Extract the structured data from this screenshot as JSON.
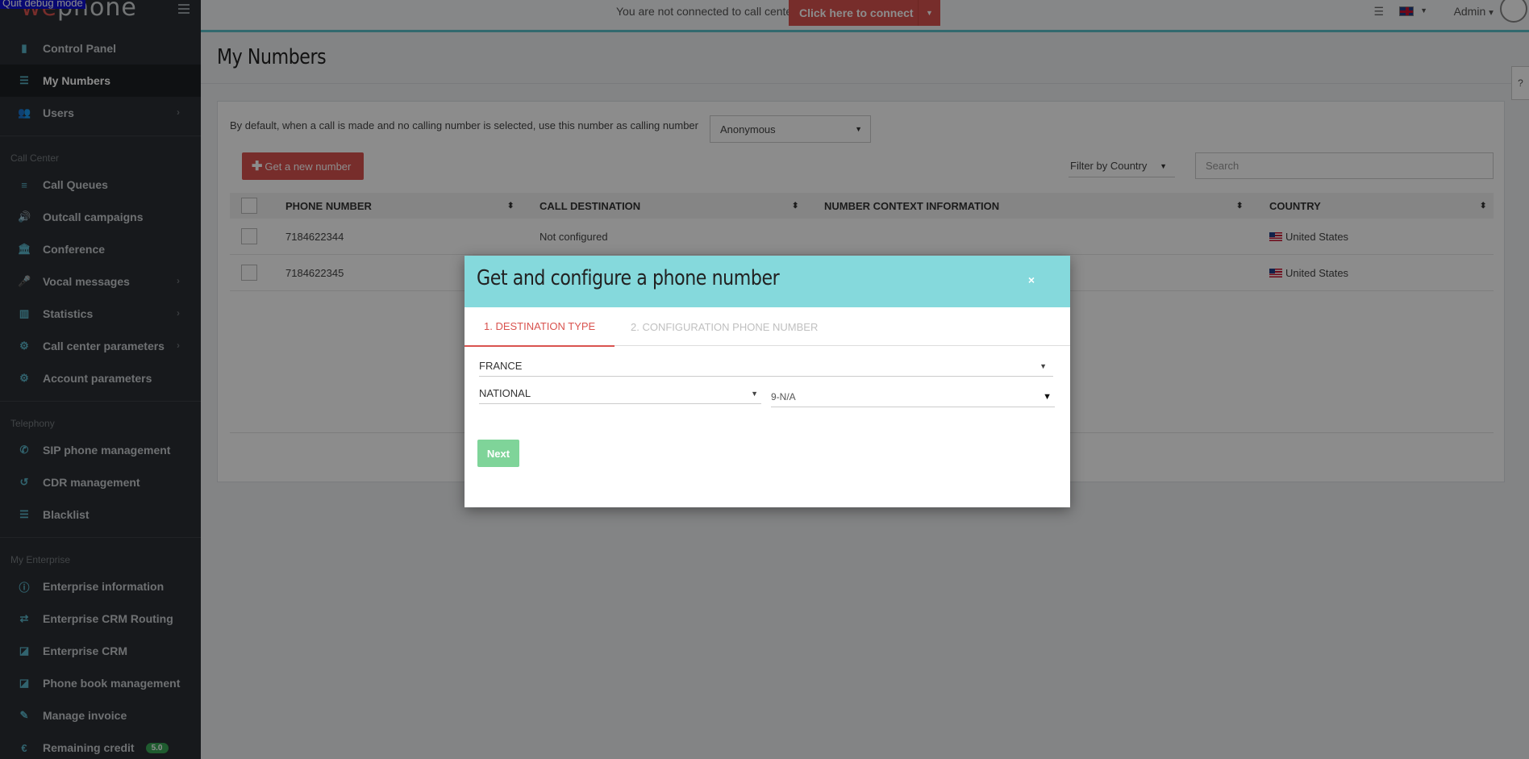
{
  "debug_banner": "Quit debug mode",
  "logo": {
    "part1": "we",
    "part2": "phone"
  },
  "sidebar": {
    "items_main": [
      {
        "label": "Control Panel",
        "icon": "bar-chart-icon",
        "glyph": "▮"
      },
      {
        "label": "My Numbers",
        "icon": "list-icon",
        "glyph": "☰"
      },
      {
        "label": "Users",
        "icon": "users-icon",
        "glyph": "👥"
      }
    ],
    "section_call_center": "Call Center",
    "items_call_center": [
      {
        "label": "Call Queues",
        "icon": "queue-icon",
        "glyph": "≡"
      },
      {
        "label": "Outcall campaigns",
        "icon": "volume-icon",
        "glyph": "🔊"
      },
      {
        "label": "Conference",
        "icon": "bank-icon",
        "glyph": "🏛"
      },
      {
        "label": "Vocal messages",
        "icon": "microphone-icon",
        "glyph": "🎤"
      },
      {
        "label": "Statistics",
        "icon": "chart-icon",
        "glyph": "▥"
      },
      {
        "label": "Call center parameters",
        "icon": "gears-icon",
        "glyph": "⚙"
      },
      {
        "label": "Account parameters",
        "icon": "gear-icon",
        "glyph": "⚙"
      }
    ],
    "section_telephony": "Telephony",
    "items_telephony": [
      {
        "label": "SIP phone management",
        "icon": "phone-icon",
        "glyph": "✆"
      },
      {
        "label": "CDR management",
        "icon": "history-icon",
        "glyph": "↺"
      },
      {
        "label": "Blacklist",
        "icon": "list-icon",
        "glyph": "☰"
      }
    ],
    "section_enterprise": "My Enterprise",
    "items_enterprise": [
      {
        "label": "Enterprise information",
        "icon": "info-icon",
        "glyph": "ⓘ"
      },
      {
        "label": "Enterprise CRM Routing",
        "icon": "exchange-icon",
        "glyph": "⇄"
      },
      {
        "label": "Enterprise CRM",
        "icon": "share-icon",
        "glyph": "◪"
      },
      {
        "label": "Phone book management",
        "icon": "share-icon",
        "glyph": "◪"
      },
      {
        "label": "Manage invoice",
        "icon": "edit-icon",
        "glyph": "✎"
      },
      {
        "label": "Remaining credit",
        "icon": "euro-icon",
        "glyph": "€"
      }
    ],
    "credit_badge": "5.0"
  },
  "topbar": {
    "connect_text": "You are not connected to call center",
    "connect_button": "Click here to connect",
    "admin_label": "Admin"
  },
  "page": {
    "title": "My Numbers",
    "default_text": "By default, when a call is made and no calling number is selected, use this number as calling number",
    "default_select": "Anonymous",
    "new_number_button": "Get a new number",
    "filter_country": "Filter by Country",
    "search_placeholder": "Search"
  },
  "table": {
    "headers": [
      "PHONE NUMBER",
      "CALL DESTINATION",
      "NUMBER CONTEXT INFORMATION",
      "COUNTRY"
    ],
    "rows": [
      {
        "phone": "7184622344",
        "destination": "Not configured",
        "context": "",
        "country": "United States"
      },
      {
        "phone": "7184622345",
        "destination": "",
        "context": "",
        "country": "United States"
      }
    ]
  },
  "modal": {
    "title": "Get and configure a phone number",
    "close": "×",
    "tab1": "1. DESTINATION TYPE",
    "tab2": "2. CONFIGURATION PHONE NUMBER",
    "country_value": "FRANCE",
    "type_value": "NATIONAL",
    "prefix_value": "9-N/A",
    "next_button": "Next"
  }
}
